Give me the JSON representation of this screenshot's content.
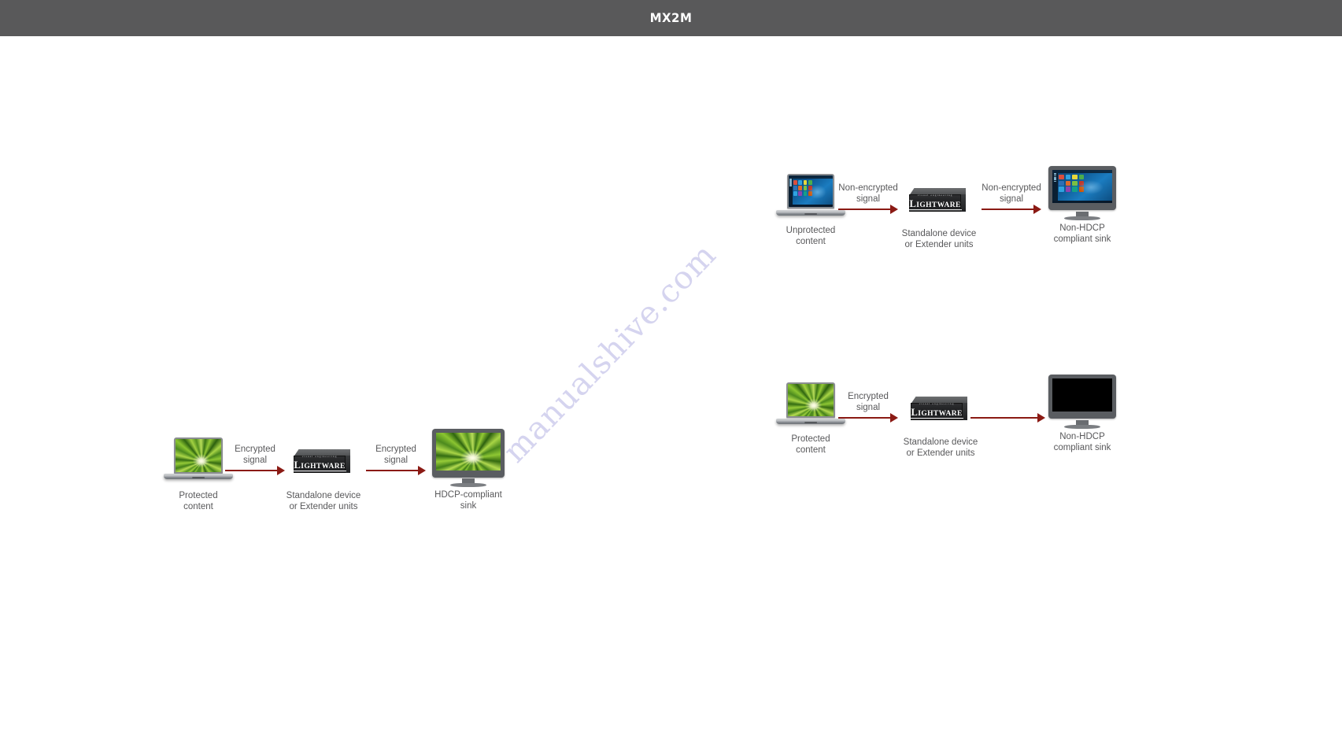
{
  "header": {
    "logo": "MX2M"
  },
  "watermark": {
    "text": "manualshive.com"
  },
  "labels": {
    "encrypted_signal": "Encrypted\nsignal",
    "non_encrypted_signal": "Non-encrypted\nsignal",
    "protected_content": "Protected\ncontent",
    "unprotected_content": "Unprotected\ncontent",
    "standalone_device": "Standalone device\nor Extender units",
    "hdcp_compliant_sink": "HDCP-compliant\nsink",
    "non_hdcp_compliant_sink": "Non-HDCP\ncompliant sink"
  },
  "device_logo": {
    "tagline": "visual engineering",
    "initial": "L",
    "name": "IGHTWARE"
  },
  "colors": {
    "header_bg": "#59595a",
    "arrow": "#8b1a14",
    "caption_text": "#58585a",
    "watermark": "#c8c6ea",
    "page_bg": "#ffffff"
  },
  "diagrams": [
    {
      "id": "diagram-protected-to-hdcp-sink",
      "source": {
        "type": "laptop",
        "screen": "palm-wallpaper",
        "caption": "Protected\ncontent"
      },
      "arrow1": {
        "label": "Encrypted\nsignal"
      },
      "device": {
        "type": "lightware-box",
        "caption": "Standalone device\nor Extender units"
      },
      "arrow2": {
        "label": "Encrypted\nsignal"
      },
      "sink": {
        "type": "monitor",
        "screen": "palm-wallpaper",
        "caption": "HDCP-compliant\nsink"
      }
    },
    {
      "id": "diagram-unprotected-to-non-hdcp-sink",
      "source": {
        "type": "laptop",
        "screen": "windows-desktop",
        "caption": "Unprotected\ncontent"
      },
      "arrow1": {
        "label": "Non-encrypted\nsignal"
      },
      "device": {
        "type": "lightware-box",
        "caption": "Standalone device\nor Extender units"
      },
      "arrow2": {
        "label": "Non-encrypted\nsignal"
      },
      "sink": {
        "type": "monitor",
        "screen": "windows-desktop",
        "caption": "Non-HDCP\ncompliant sink"
      }
    },
    {
      "id": "diagram-protected-to-non-hdcp-sink",
      "source": {
        "type": "laptop",
        "screen": "palm-wallpaper",
        "caption": "Protected\ncontent"
      },
      "arrow1": {
        "label": "Encrypted\nsignal"
      },
      "device": {
        "type": "lightware-box",
        "caption": "Standalone device\nor Extender units"
      },
      "arrow2": {
        "label": ""
      },
      "sink": {
        "type": "monitor",
        "screen": "blank-black",
        "caption": "Non-HDCP\ncompliant sink"
      }
    }
  ]
}
